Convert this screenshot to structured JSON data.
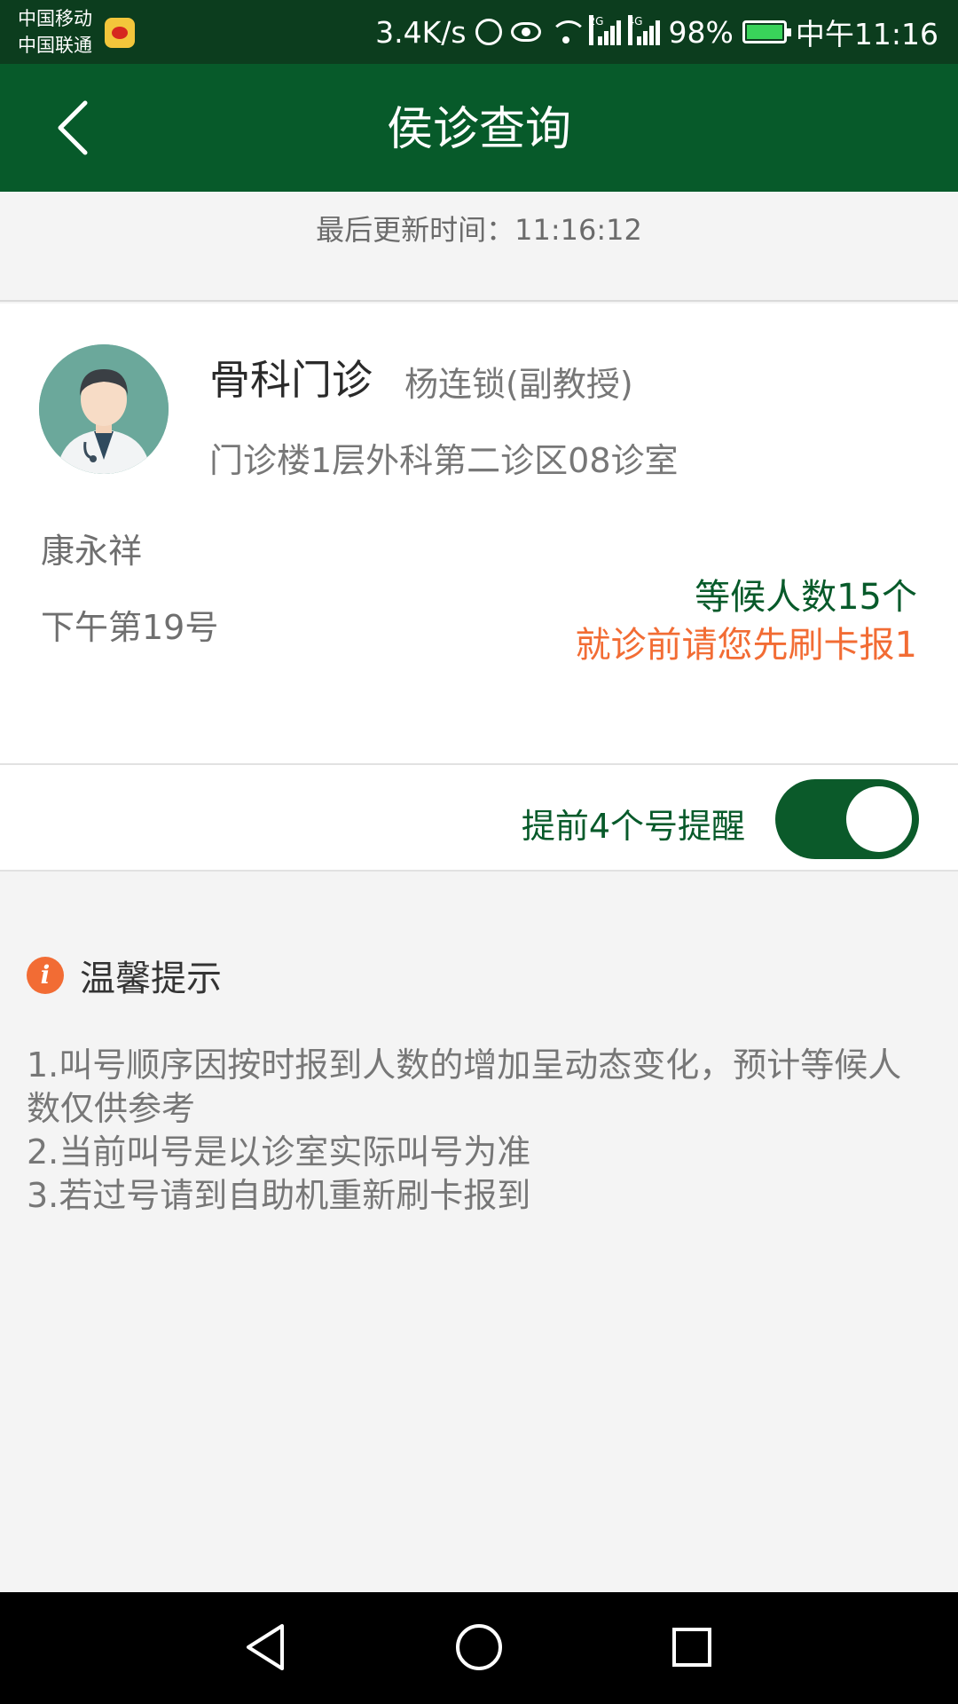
{
  "status_bar": {
    "carrier_1": "中国移动",
    "carrier_2": "中国联通",
    "speed": "3.4K/s",
    "signal_1_tag": "2G",
    "signal_2_tag": "4G",
    "battery": "98%",
    "time": "中午11:16"
  },
  "header": {
    "title": "侯诊查询"
  },
  "update": {
    "text": "最后更新时间：11:16:12"
  },
  "card": {
    "department": "骨科门诊",
    "doctor": "杨连锁(副教授)",
    "room": "门诊楼1层外科第二诊区08诊室",
    "patient": "康永祥",
    "queue_number": "下午第19号",
    "waiting": "等候人数15个",
    "notice": "就诊前请您先刷卡报1"
  },
  "reminder": {
    "label": "提前4个号提醒",
    "enabled": true
  },
  "tips": {
    "title": "温馨提示",
    "lines": [
      "1.叫号顺序因按时报到人数的增加呈动态变化，预计等候人数仅供参考",
      "2.当前叫号是以诊室实际叫号为准",
      "3.若过号请到自助机重新刷卡报到"
    ]
  },
  "colors": {
    "header_bg": "#075a2a",
    "accent_green": "#075a2a",
    "accent_orange": "#f26c34"
  }
}
